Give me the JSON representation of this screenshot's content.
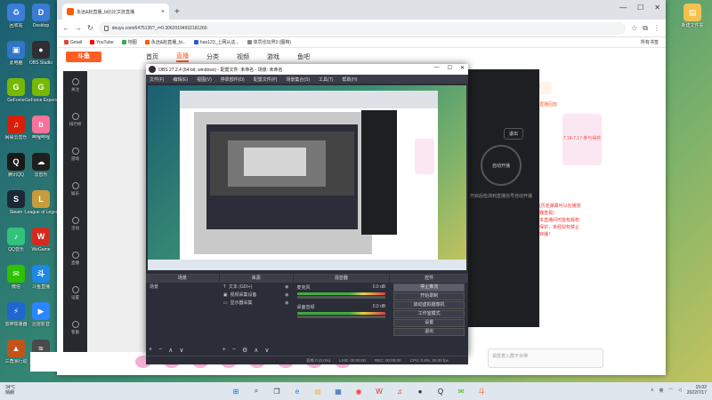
{
  "desktop": {
    "left_icons": [
      {
        "label": "回收站",
        "color": "#3b7dd8",
        "glyph": "♻"
      },
      {
        "label": "此电脑",
        "color": "#2f76c9",
        "glyph": "▣"
      },
      {
        "label": "GeForce",
        "color": "#76b900",
        "glyph": "G"
      },
      {
        "label": "网易云音乐",
        "color": "#d81e06",
        "glyph": "♫"
      },
      {
        "label": "腾讯QQ",
        "color": "#1a1a1a",
        "glyph": "Q"
      },
      {
        "label": "Steam",
        "color": "#1b2838",
        "glyph": "S"
      },
      {
        "label": "QQ音乐",
        "color": "#31c27c",
        "glyph": "♪"
      },
      {
        "label": "微信",
        "color": "#2dc100",
        "glyph": "✉"
      },
      {
        "label": "雷神加速器",
        "color": "#1e66d0",
        "glyph": "⚡"
      },
      {
        "label": "三角洲行动",
        "color": "#c2541a",
        "glyph": "▲"
      }
    ],
    "mid_icons": [
      {
        "label": "Desktop",
        "color": "#3a7bd5",
        "glyph": "D"
      },
      {
        "label": "OBS Studio",
        "color": "#302e31",
        "glyph": "●"
      },
      {
        "label": "GeForce Experience",
        "color": "#76b900",
        "glyph": "G"
      },
      {
        "label": "哔哩哔哩",
        "color": "#fb7299",
        "glyph": "b"
      },
      {
        "label": "云音乐",
        "color": "#1f1f1f",
        "glyph": "☁"
      },
      {
        "label": "League of Legends",
        "color": "#c89b3c",
        "glyph": "L"
      },
      {
        "label": "WeGame",
        "color": "#d52b1e",
        "glyph": "W"
      },
      {
        "label": "斗鱼直播",
        "color": "#1e88e5",
        "glyph": "斗"
      },
      {
        "label": "迅雷影音",
        "color": "#2b86ff",
        "glyph": "▶"
      },
      {
        "label": "Clash",
        "color": "#4a4a4a",
        "glyph": "≈"
      }
    ],
    "right_icons": [
      {
        "label": "新建文件夹",
        "color": "#f2c14e",
        "glyph": "▤"
      }
    ]
  },
  "browser": {
    "tab_title": "永远&赵直播_bi比比文抚直播",
    "url": "douyu.com/6475135?_r=0.30620194932181266",
    "window_controls": [
      "—",
      "☐",
      "✕"
    ],
    "bookmarks": [
      {
        "label": "Gmail",
        "color": "#ea4335"
      },
      {
        "label": "YouTube",
        "color": "#ff0000"
      },
      {
        "label": "地图",
        "color": "#34a853"
      },
      {
        "label": "永远&赵直播_bi...",
        "color": "#ff5a00"
      },
      {
        "label": "hao123_上网从这...",
        "color": "#2a5bd7"
      },
      {
        "label": "体罚论坛界3 (图档)",
        "color": "#888888"
      }
    ],
    "bookmarks_right": "所有书签"
  },
  "douyu": {
    "logo": "斗鱼",
    "nav": [
      "首页",
      "直播",
      "分类",
      "视频",
      "游戏",
      "鱼吧"
    ],
    "active_nav": "直播",
    "sidebar": [
      "关注",
      "排行榜",
      "游戏",
      "娱乐",
      "活动",
      "直播",
      "设置",
      "客服"
    ],
    "right_panel": {
      "gift_label": "PC版PK赛",
      "badge": "直播回放",
      "ad_text": "7.18-7.17 参与得奖",
      "chat_placeholder": "说愿意入群不许停",
      "notice_lines": [
        "(历史弹幕可以在播放",
        "器查看)",
        "本直播间可能有版权",
        "保护，未经授权禁止",
        "转播！"
      ]
    }
  },
  "dark_panel": {
    "circle_label": "自动开播",
    "exit_label": "退出",
    "tip": "开启后检测到直播信号自动开播"
  },
  "obs": {
    "title": "OBS 27.2.4 (64-bit, windows) - 配置文件: 未命名 - 场景: 未命名",
    "menu": [
      "文件(F)",
      "编辑(E)",
      "视图(V)",
      "停靠部件(D)",
      "配置文件(P)",
      "场景集合(S)",
      "工具(T)",
      "帮助(H)"
    ],
    "panels": {
      "scenes": {
        "title": "场景",
        "items": [
          "场景"
        ]
      },
      "sources": {
        "title": "来源",
        "items": [
          "文本 (GDI+)",
          "视频采集设备",
          "显示器采集"
        ]
      },
      "mixer": {
        "title": "混音器",
        "channels": [
          {
            "name": "麦克风",
            "db": "0.0 dB"
          },
          {
            "name": "桌面音频",
            "db": "0.0 dB"
          }
        ]
      },
      "transitions": {
        "title": "转场动画"
      },
      "controls": {
        "title": "控件",
        "buttons": [
          "停止推流",
          "开始录制",
          "启动虚拟摄像机",
          "工作室模式",
          "设置",
          "退出"
        ],
        "active_button": "停止推流"
      }
    },
    "status": [
      "丢帧 0 (0.0%)",
      "LIVE: 00:00:00",
      "REC: 00:00:00",
      "CPU: 0.8%, 30.00 fps"
    ]
  },
  "taskbar": {
    "weather": [
      "34°C",
      "晴朗"
    ],
    "apps": [
      {
        "name": "start",
        "glyph": "⊞",
        "color": "#0078d4"
      },
      {
        "name": "search",
        "glyph": "⌕",
        "color": "#333333"
      },
      {
        "name": "task-view",
        "glyph": "❐",
        "color": "#333333"
      },
      {
        "name": "edge",
        "glyph": "e",
        "color": "#0c7bd9"
      },
      {
        "name": "explorer",
        "glyph": "▤",
        "color": "#f2b53c"
      },
      {
        "name": "store",
        "glyph": "▦",
        "color": "#2b5fb4"
      },
      {
        "name": "chrome",
        "glyph": "◉",
        "color": "#ea4335"
      },
      {
        "name": "wps",
        "glyph": "W",
        "color": "#d22f27"
      },
      {
        "name": "netease",
        "glyph": "♫",
        "color": "#d81e06"
      },
      {
        "name": "obs",
        "glyph": "●",
        "color": "#302e31"
      },
      {
        "name": "qq",
        "glyph": "Q",
        "color": "#1a1a1a"
      },
      {
        "name": "wechat",
        "glyph": "✉",
        "color": "#2dc100"
      },
      {
        "name": "douyu",
        "glyph": "斗",
        "color": "#ff5d23"
      }
    ],
    "ime": "英",
    "time": "15:02",
    "date": "2022/7/17"
  }
}
